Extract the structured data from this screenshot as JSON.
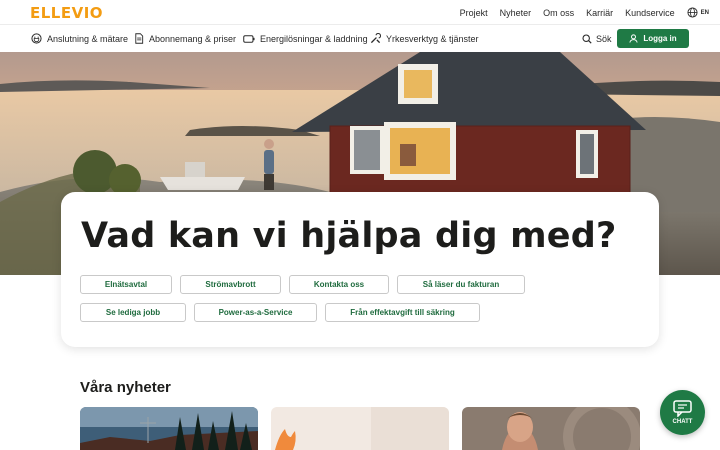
{
  "brand": {
    "logo_text": "ELLEVIO",
    "accent_color": "#f39c12",
    "primary_green": "#1f7a45"
  },
  "topbar": {
    "links": [
      "Projekt",
      "Nyheter",
      "Om oss",
      "Karriär",
      "Kundservice"
    ],
    "language": {
      "icon": "globe-icon",
      "label": "EN"
    }
  },
  "nav": {
    "items": [
      {
        "label": "Anslutning & mätare",
        "icon": "plug-icon"
      },
      {
        "label": "Abonnemang & priser",
        "icon": "document-icon"
      },
      {
        "label": "Energilösningar & laddning",
        "icon": "battery-icon"
      },
      {
        "label": "Yrkesverktyg & tjänster",
        "icon": "tools-icon"
      }
    ],
    "search_label": "Sök",
    "search_icon": "search-icon",
    "login_label": "Logga in",
    "login_icon": "user-icon"
  },
  "hero": {
    "heading": "Vad kan vi hjälpa dig med?",
    "chips_row1": [
      "Elnätsavtal",
      "Strömavbrott",
      "Kontakta oss",
      "Så läser du fakturan"
    ],
    "chips_row2": [
      "Se lediga jobb",
      "Power-as-a-Service",
      "Från effektavgift till säkring"
    ]
  },
  "news": {
    "heading": "Våra nyheter"
  },
  "chat": {
    "label": "CHATT",
    "icon": "chat-icon"
  }
}
